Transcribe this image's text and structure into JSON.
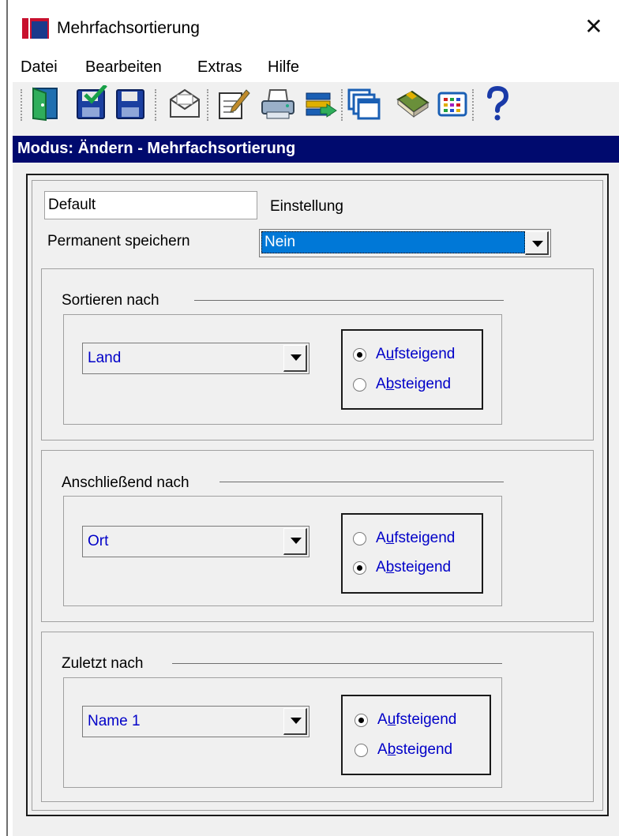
{
  "window": {
    "title": "Mehrfachsortierung",
    "close_symbol": "✕"
  },
  "menu": [
    "Datei",
    "Bearbeiten",
    "Extras",
    "Hilfe"
  ],
  "toolbar_icons": [
    "exit-door-icon",
    "save-check-icon",
    "save-icon",
    "mail-icon",
    "edit-document-icon",
    "printer-icon",
    "export-icon",
    "windows-icon",
    "book-icon",
    "table-icon",
    "help-icon"
  ],
  "mode_bar": "Modus: Ändern - Mehrfachsortierung",
  "setting": {
    "name_value": "Default",
    "name_label": "Einstellung",
    "permanent_label": "Permanent speichern",
    "permanent_value": "Nein"
  },
  "groups": [
    {
      "heading": "Sortieren nach",
      "field": "Land",
      "selected": "asc"
    },
    {
      "heading": "Anschließend nach",
      "field": "Ort",
      "selected": "desc"
    },
    {
      "heading": "Zuletzt nach",
      "field": "Name 1",
      "selected": "asc"
    }
  ],
  "radio_labels": {
    "asc_prefix": "A",
    "asc_mnemonic": "u",
    "asc_rest": "fsteigend",
    "desc_prefix": "A",
    "desc_mnemonic": "b",
    "desc_rest": "steigend"
  },
  "colors": {
    "mode_bar": "#000a6e",
    "value_text": "#0000c8",
    "selection": "#0078d7"
  }
}
